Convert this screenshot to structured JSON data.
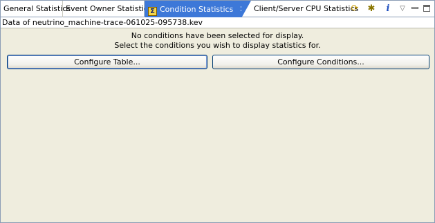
{
  "tabs": [
    {
      "label": "General Statistics",
      "active": false
    },
    {
      "label": "Event Owner Statistics",
      "active": false
    },
    {
      "label": "Condition Statistics",
      "active": true,
      "icon": "sigma-icon"
    },
    {
      "label": "Client/Server CPU Statistics",
      "active": false
    }
  ],
  "tab_close_glyph": "✕",
  "toolbar": {
    "icons": [
      "sync-icon",
      "pin-icon",
      "info-icon",
      "view-menu-icon",
      "minimize-icon",
      "maximize-icon"
    ],
    "info_glyph": "i",
    "menu_glyph": "▽"
  },
  "source_label": "Data of neutrino_machine-trace-061025-095738.kev",
  "message_line1": "No conditions have been selected for display.",
  "message_line2": "Select the conditions you wish to display statistics for.",
  "buttons": {
    "configure_table": "Configure Table...",
    "configure_conditions": "Configure Conditions..."
  },
  "colors": {
    "active_tab": "#3d78d8",
    "panel_background": "#efedde",
    "border": "#8a9cb5"
  }
}
